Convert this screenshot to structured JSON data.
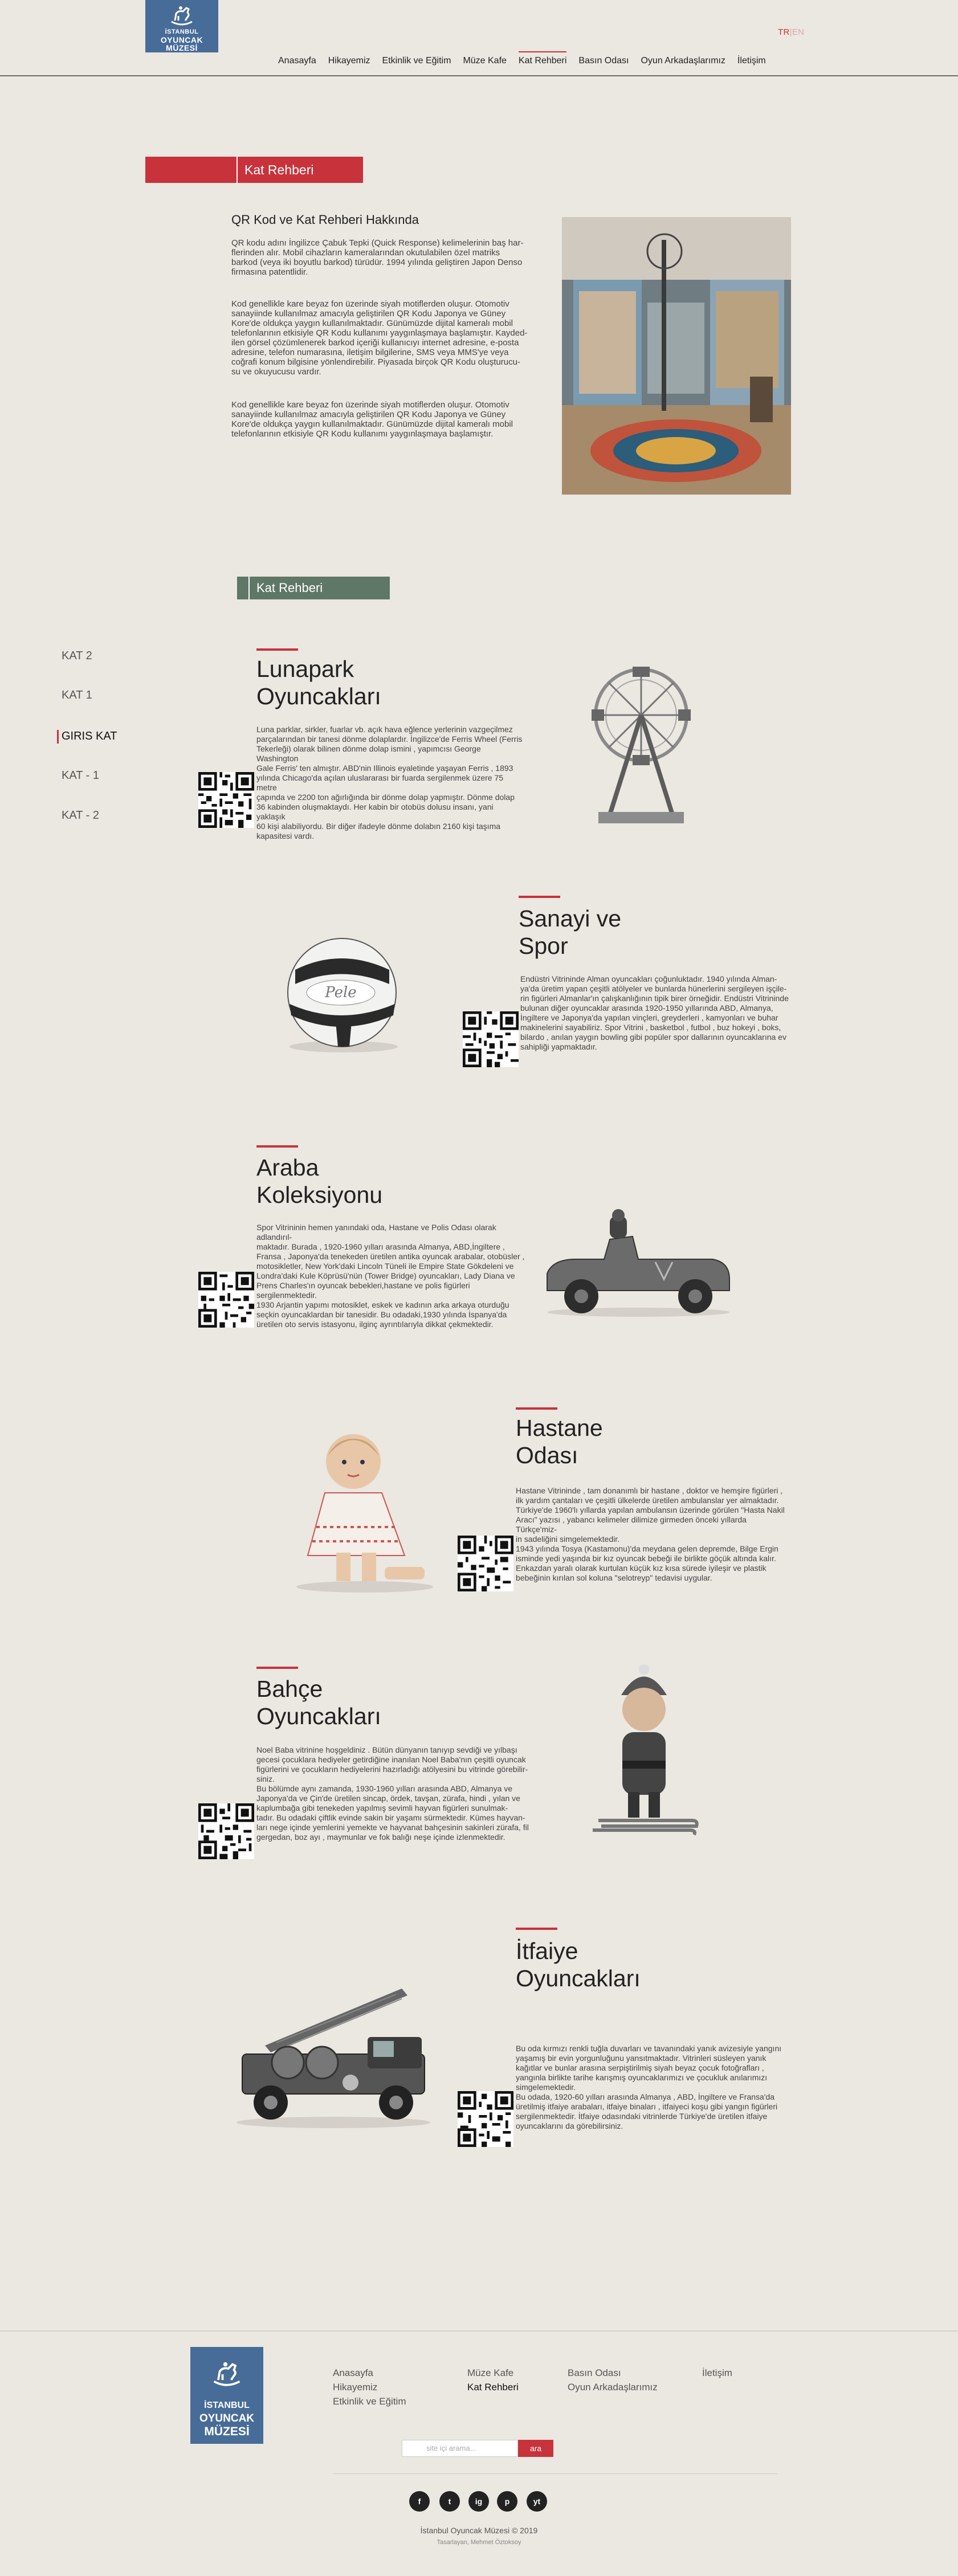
{
  "header": {
    "logo": {
      "line1": "İSTANBUL",
      "line2": "OYUNCAK",
      "line3": "MÜZESİ"
    },
    "lang": {
      "tr": "TR",
      "separator": "|",
      "en": "EN"
    },
    "nav": [
      "Anasayfa",
      "Hikayemiz",
      "Etkinlik ve Eğitim",
      "Müze Kafe",
      "Kat Rehberi",
      "Basın Odası",
      "Oyun Arkadaşlarımız",
      "İletişim"
    ]
  },
  "page_title": "Kat Rehberi",
  "intro": {
    "heading": "QR Kod ve Kat Rehberi Hakkında",
    "para1": [
      "QR kodu adını İngilizce Çabuk Tepki (Quick Response) kelimelerinin baş har-",
      "flerinden alır. Mobil cihazların kameralarından okutulabilen özel matriks",
      "barkod (veya iki boyutlu barkod) türüdür. 1994 yılında geliştiren Japon Denso",
      "firmasına patentlidir."
    ],
    "para2": [
      "Kod genellikle kare beyaz fon üzerinde siyah motiflerden oluşur. Otomotiv",
      "sanayiinde kullanılmaz amacıyla geliştirilen QR Kodu Japonya ve Güney",
      "Kore'de oldukça yaygın kullanılmaktadır. Günümüzde dijital kameralı mobil",
      "telefonlarının etkisiyle QR Kodu kullanımı yaygınlaşmaya başlamıştır. Kayded-",
      "ilen görsel çözümlenerek barkod içeriği kullanıcıyı internet adresine, e-posta",
      "adresine, telefon numarasına, iletişim bilgilerine, SMS veya MMS'ye veya",
      "coğrafi konum bilgisine yönlendirebilir. Piyasada birçok QR Kodu oluşturucu-",
      "su ve okuyucusu vardır."
    ],
    "para3": [
      "Kod genellikle kare beyaz fon üzerinde siyah motiflerden oluşur. Otomotiv",
      "sanayiinde kullanılmaz amacıyla geliştirilen QR Kodu Japonya ve Güney",
      "Kore'de oldukça yaygın kullanılmaktadır. Günümüzde dijital kameralı mobil",
      "telefonlarının etkisiyle QR Kodu kullanımı yaygınlaşmaya başlamıştır."
    ]
  },
  "qr_tag": "Kat Rehberi",
  "side_nav": [
    "KAT 2",
    "KAT 1",
    "GIRIS KAT",
    "KAT - 1",
    "KAT - 2"
  ],
  "side_active": "GIRIS KAT",
  "sections": [
    {
      "title": [
        "Lunapark",
        "Oyuncakları"
      ],
      "lines": [
        "Luna parklar, sirkler, fuarlar vb. açık hava eğlence yerlerinin vazgeçilmez",
        "parçalarından bir tanesi dönme dolaplardır. İngilizce'de Ferris Wheel (Ferris",
        "Tekerleği) olarak bilinen dönme dolap ismini , yapımcısı George Washington",
        "Gale Ferris' ten almıştır. ABD'nin Illinois eyaletinde yaşayan Ferris , 1893",
        "yılında Chicago'da açılan uluslararası bir fuarda sergilenmek üzere 75 metre",
        "çapında ve 2200 ton ağırlığında bir dönme dolap yapmıştır. Dönme dolap",
        "36 kabinden oluşmaktaydı. Her kabin bir otobüs dolusu insanı, yani yaklaşık",
        "60 kişi alabiliyordu. Bir diğer ifadeyle dönme dolabın 2160 kişi taşıma",
        "kapasitesi vardı."
      ]
    },
    {
      "title": [
        "Sanayi ve",
        "Spor"
      ],
      "lines": [
        "Endüstri Vitrininde Alman oyuncakları çoğunluktadır. 1940 yılında Alman-",
        "ya'da üretim yapan çeşitli atölyeler ve bunlarda hünerlerini sergileyen işçile-",
        "rin figürleri Almanlar'ın çalışkanlığının tipik birer örneğidir. Endüstri Vitrininde",
        "bulunan diğer oyuncaklar arasında 1920-1950 yıllarında ABD, Almanya,",
        "İngiltere ve Japonya'da yapılan vinçleri, greyderleri , kamyonları ve buhar",
        "makinelerini sayabiliriz. Spor Vitrini , basketbol , futbol , buz hokeyi , boks,",
        "bilardo , anılan yaygın bowling gibi popüler spor dallarının oyuncaklarına ev",
        "sahipliği yapmaktadır."
      ]
    },
    {
      "title": [
        "Araba",
        "Koleksiyonu"
      ],
      "lines": [
        "Spor Vitrininin hemen yanındaki oda, Hastane ve Polis Odası olarak adlandırıl-",
        "maktadır. Burada , 1920-1960 yılları arasında Almanya, ABD,İngiltere ,",
        "Fransa , Japonya'da tenekeden üretilen antika oyuncak arabalar, otobüsler ,",
        "motosikletler, New York'daki Lincoln Tüneli ile Empire State Gökdeleni ve",
        "Londra'daki Kule Köprüsü'nün (Tower Bridge) oyuncakları, Lady Diana ve",
        "Prens Charles'ın oyuncak bebekleri,hastane ve polis figürleri sergilenmektedir.",
        "1930 Arjantin yapımı motosiklet, eskek ve kadının arka arkaya oturduğu",
        "seçkin oyuncaklardan bir tanesidir. Bu odadaki,1930 yılında İspanya'da",
        "üretilen oto servis istasyonu, ilginç ayrıntılarıyla dikkat çekmektedir."
      ]
    },
    {
      "title": [
        "Hastane",
        "Odası"
      ],
      "lines": [
        "Hastane Vitrininde , tam donanımlı bir hastane , doktor ve hemşire figürleri ,",
        "ilk yardım çantaları ve çeşitli ülkelerde üretilen ambulanslar yer almaktadır.",
        "Türkiye'de 1960'lı yıllarda yapılan ambulansın üzerinde görülen \"Hasta Nakil",
        "Aracı\" yazısı , yabancı kelimeler dilimize girmeden önceki yıllarda Türkçe'miz-",
        "in sadeliğini simgelemektedir.",
        "1943 yılında Tosya (Kastamonu)'da meydana gelen depremde, Bilge Ergin",
        "isminde yedi yaşında bir kız oyuncak bebeği ile birlikte göçük altında kalır.",
        "Enkazdan yaralı olarak kurtulan küçük kız kısa sürede iyileşir ve plastik",
        "bebeğinin kırılan sol koluna \"selotreyp\" tedavisi uygular."
      ]
    },
    {
      "title": [
        "Bahçe",
        "Oyuncakları"
      ],
      "lines": [
        "Noel Baba vitrinine hoşgeldiniz . Bütün dünyanın tanıyıp sevdiği ve yılbaşı",
        "gecesi çocuklara hediyeler getirdiğine inanılan Noel Baba'nın çeşitli oyuncak",
        "figürlerini ve çocukların hediyelerini hazırladığı atölyesini bu vitrinde görebilir-",
        "siniz.",
        "Bu bölümde aynı zamanda, 1930-1960 yılları arasında ABD, Almanya ve",
        "Japonya'da ve Çin'de üretilen sincap, ördek, tavşan, zürafa, hindi , yılan ve",
        "kaplumbağa gibi tenekeden yapılmış sevimli hayvan figürleri sunulmak-",
        "tadır. Bu odadaki çiftlik evinde sakin bir yaşamı sürmektedir. Kümes hayvan-",
        "ları nege içinde yemlerini yemekte ve hayvanat bahçesinin sakinleri zürafa, fil",
        "gergedan, boz ayı , maymunlar ve fok balığı neşe içinde izlenmektedir."
      ]
    },
    {
      "title": [
        "İtfaiye",
        "Oyuncakları"
      ],
      "lines": [
        "Bu oda kırmızı renkli tuğla duvarları ve tavanındaki yanık avizesiyle yangını",
        "yaşamış bir evin yorgunluğunu yansıtmaktadır. Vitrinleri süsleyen yanık",
        "kağıtlar ve bunlar arasına serpiştirilmiş siyah beyaz çocuk fotoğrafları ,",
        "yangınla birlikte tarihe karışmış oyuncaklarımızı ve çocukluk anılarımızı",
        "simgelemektedir.",
        "Bu odada, 1920-60 yılları arasında Almanya , ABD, İngiltere ve Fransa'da",
        "üretilmiş itfaiye arabaları, itfaiye binaları , itfaiyeci koşu gibi yangın figürleri",
        "sergilenmektedir. İtfaiye odasındaki vitrinlerde Türkiye'de üretilen itfaiye",
        "oyuncaklarını da görebilirsiniz."
      ]
    }
  ],
  "footer": {
    "logo": {
      "line1": "İSTANBUL",
      "line2": "OYUNCAK",
      "line3": "MÜZESİ"
    },
    "col1": [
      "Anasayfa",
      "Hikayemiz",
      "Etkinlik ve Eğitim"
    ],
    "col2": [
      "Müze Kafe",
      "Kat Rehberi"
    ],
    "col3": [
      "Basın Odası",
      "Oyun Arkadaşlarımız"
    ],
    "col4": [
      "İletişim"
    ],
    "search_placeholder": "site içi arama...",
    "search_button": "ara",
    "social": [
      "f",
      "t",
      "ig",
      "p",
      "yt"
    ],
    "copyright": "İstanbul Oyuncak Müzesi © 2019",
    "credit": "Tasarlayan, Mehmet Öztoksoy"
  },
  "colors": {
    "accent": "#c8323b",
    "brand": "#486c98",
    "tag": "#5f7766",
    "background": "#ebe7e1"
  }
}
